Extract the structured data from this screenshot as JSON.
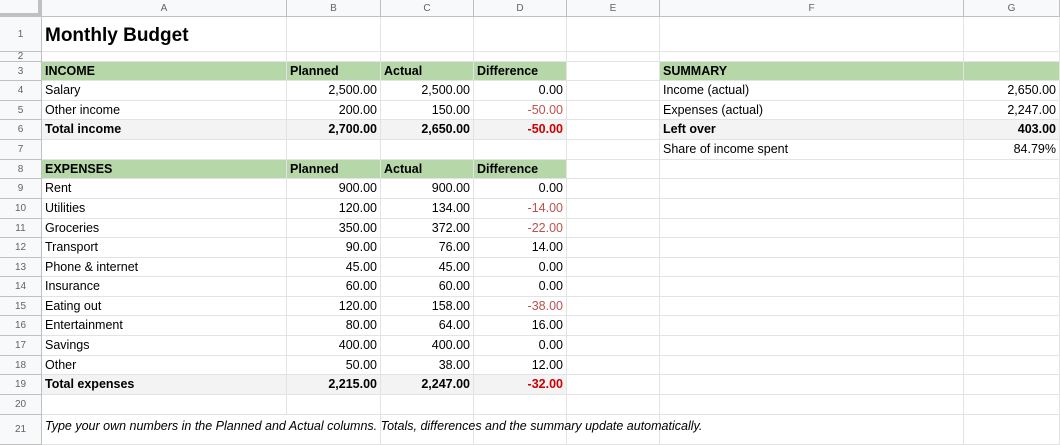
{
  "columns": [
    "A",
    "B",
    "C",
    "D",
    "E",
    "F",
    "G"
  ],
  "row_numbers": [
    "1",
    "2",
    "3",
    "4",
    "5",
    "6",
    "7",
    "8",
    "9",
    "10",
    "11",
    "12",
    "13",
    "14",
    "15",
    "16",
    "17",
    "18",
    "19",
    "20",
    "21"
  ],
  "title": "Monthly Budget",
  "income": {
    "header": [
      "INCOME",
      "Planned",
      "Actual",
      "Difference"
    ],
    "rows": [
      [
        "Salary",
        "2,500.00",
        "2,500.00",
        "0.00"
      ],
      [
        "Other income",
        "200.00",
        "150.00",
        "-50.00"
      ]
    ],
    "total": [
      "Total income",
      "2,700.00",
      "2,650.00",
      "-50.00"
    ]
  },
  "expenses": {
    "header": [
      "EXPENSES",
      "Planned",
      "Actual",
      "Difference"
    ],
    "rows": [
      [
        "Rent",
        "900.00",
        "900.00",
        "0.00"
      ],
      [
        "Utilities",
        "120.00",
        "134.00",
        "-14.00"
      ],
      [
        "Groceries",
        "350.00",
        "372.00",
        "-22.00"
      ],
      [
        "Transport",
        "90.00",
        "76.00",
        "14.00"
      ],
      [
        "Phone & internet",
        "45.00",
        "45.00",
        "0.00"
      ],
      [
        "Insurance",
        "60.00",
        "60.00",
        "0.00"
      ],
      [
        "Eating out",
        "120.00",
        "158.00",
        "-38.00"
      ],
      [
        "Entertainment",
        "80.00",
        "64.00",
        "16.00"
      ],
      [
        "Savings",
        "400.00",
        "400.00",
        "0.00"
      ],
      [
        "Other",
        "50.00",
        "38.00",
        "12.00"
      ]
    ],
    "total": [
      "Total expenses",
      "2,215.00",
      "2,247.00",
      "-32.00"
    ]
  },
  "summary": {
    "header": "SUMMARY",
    "rows": [
      [
        "Income (actual)",
        "2,650.00"
      ],
      [
        "Expenses (actual)",
        "2,247.00"
      ],
      [
        "Left over",
        "403.00"
      ],
      [
        "Share of income spent",
        "84.79%"
      ]
    ]
  },
  "note": "Type your own numbers in the Planned and Actual columns. Totals, differences and the summary update automatically.",
  "colors": {
    "header_fill": "#b6d7a8",
    "total_fill": "#f3f3f3",
    "negative": "#c0504d"
  }
}
